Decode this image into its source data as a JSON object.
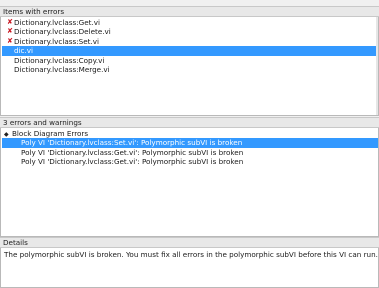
{
  "items_section": {
    "title": "Items with errors",
    "items": [
      {
        "label": "Dictionary.lvclass:Get.vi",
        "error": true,
        "selected": false
      },
      {
        "label": "Dictionary.lvclass:Delete.vi",
        "error": true,
        "selected": false
      },
      {
        "label": "Dictionary.lvclass:Set.vi",
        "error": true,
        "selected": false
      },
      {
        "label": "dic.vi",
        "error": false,
        "selected": true
      },
      {
        "label": "Dictionary.lvclass:Copy.vi",
        "error": false,
        "selected": false
      },
      {
        "label": "Dictionary.lvclass:Merge.vi",
        "error": false,
        "selected": false
      }
    ]
  },
  "warnings_section": {
    "title": "3 errors and warnings",
    "group": {
      "label": "Block Diagram Errors",
      "messages": [
        {
          "text": "Poly VI 'Dictionary.lvclass:Set.vi': Polymorphic subVI is broken",
          "selected": true
        },
        {
          "text": "Poly VI 'Dictionary.lvclass:Get.vi': Polymorphic subVI is broken",
          "selected": false
        },
        {
          "text": "Poly VI 'Dictionary.lvclass:Get.vi': Polymorphic subVI is broken",
          "selected": false
        }
      ]
    }
  },
  "details_section": {
    "title": "Details",
    "text": "The polymorphic subVI is broken. You must fix all errors in the polymorphic subVI before this VI can run."
  },
  "colors": {
    "selection": "#3399ff",
    "error_icon": "#c8141e"
  },
  "icons": {
    "error": "error-x-icon",
    "expand": "tree-expanded-icon"
  }
}
